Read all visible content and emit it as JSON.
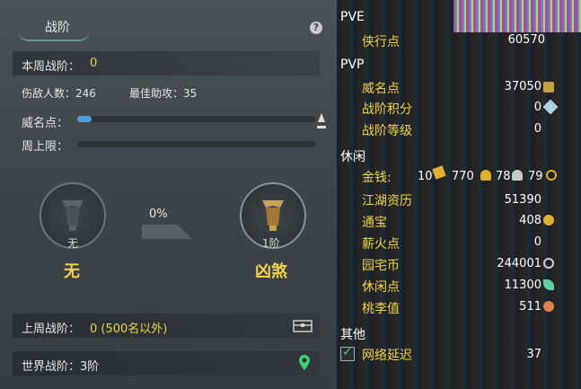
{
  "left": {
    "title": "战阶",
    "help": "?",
    "week_rank_label": "本周战阶：",
    "week_rank_value": "0",
    "kills_label": "伤敌人数：246",
    "assist_label": "最佳助攻：35",
    "prestige_label": "威名点：",
    "prestige_progress": 0.06,
    "weekly_cap_label": "周上限：",
    "weekly_cap_progress": 0,
    "current_medal_num": "无",
    "current_medal_name": "无",
    "progress_percent": "0%",
    "next_medal_num": "1阶",
    "next_medal_name": "凶煞",
    "last_week_label": "上周战阶：",
    "last_week_value": "0 (500名以外)",
    "world_rank_label": "世界战阶：3阶"
  },
  "right": {
    "pve": "PVE",
    "xiaxing_label": "侠行点",
    "xiaxing_value": "60570",
    "pvp": "PVP",
    "weiming_label": "威名点",
    "weiming_value": "37050",
    "zhanjie_points_label": "战阶积分",
    "zhanjie_points_value": "0",
    "zhanjie_level_label": "战阶等级",
    "zhanjie_level_value": "0",
    "leisure": "休闲",
    "money_label": "金钱:",
    "money_gold": "10",
    "money_silver1": "770",
    "money_silver2": "78",
    "money_copper": "79",
    "jianghu_label": "江湖资历",
    "jianghu_value": "51390",
    "tongbao_label": "通宝",
    "tongbao_value": "408",
    "xinhuo_label": "薪火点",
    "xinhuo_value": "0",
    "yuanzhai_label": "园宅币",
    "yuanzhai_value": "244001",
    "xiuxian_label": "休闲点",
    "xiuxian_value": "11300",
    "taoli_label": "桃李值",
    "taoli_value": "511",
    "other": "其他",
    "latency_label": "网络延迟",
    "latency_value": "37"
  }
}
